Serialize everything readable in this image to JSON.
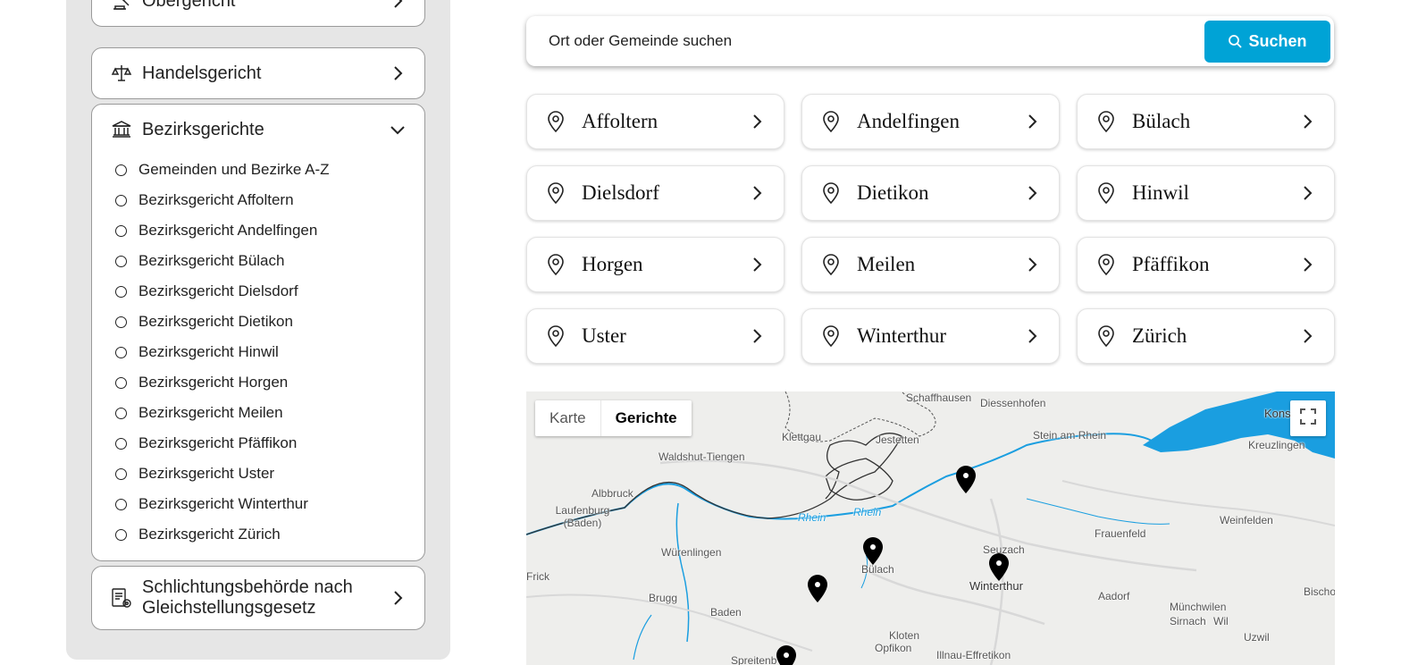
{
  "sidebar": {
    "obergericht": "Obergericht",
    "handelsgericht": "Handelsgericht",
    "bezirksgerichte": "Bezirksgerichte",
    "bezirksgerichte_items": [
      "Gemeinden und Bezirke A-Z",
      "Bezirksgericht Affoltern",
      "Bezirksgericht Andelfingen",
      "Bezirksgericht Bülach",
      "Bezirksgericht Dielsdorf",
      "Bezirksgericht Dietikon",
      "Bezirksgericht Hinwil",
      "Bezirksgericht Horgen",
      "Bezirksgericht Meilen",
      "Bezirksgericht Pfäffikon",
      "Bezirksgericht Uster",
      "Bezirksgericht Winterthur",
      "Bezirksgericht Zürich"
    ],
    "schlichtung_line1": "Schlichtungsbehörde nach",
    "schlichtung_line2": "Gleichstellungsgesetz"
  },
  "search": {
    "placeholder": "Ort oder Gemeinde suchen",
    "button_label": "Suchen"
  },
  "districts": [
    "Affoltern",
    "Andelfingen",
    "Bülach",
    "Dielsdorf",
    "Dietikon",
    "Hinwil",
    "Horgen",
    "Meilen",
    "Pfäffikon",
    "Uster",
    "Winterthur",
    "Zürich"
  ],
  "map": {
    "toggle_map": "Karte",
    "toggle_courts": "Gerichte",
    "places": [
      "Schaffhausen",
      "Diessenhofen",
      "Klettgau",
      "Jestetten",
      "Stein am Rhein",
      "Kons",
      "Kreuzlingen",
      "Waldshut-Tiengen",
      "Albbruck",
      "Laufenburg (Baden)",
      "Rhein",
      "Rhein",
      "Weinfelden",
      "Frauenfeld",
      "Würenlingen",
      "Seuzach",
      "Bülach",
      "Winterthur",
      "Frick",
      "Brugg",
      "Baden",
      "Aadorf",
      "Bischo",
      "Münchwilen",
      "Sirnach",
      "Wil",
      "Kloten",
      "Opfikon",
      "Illnau-Effretikon",
      "Uzwil",
      "Spreitenb"
    ]
  },
  "colors": {
    "accent": "#00a3d6",
    "sidebar_bg": "#e6e6e6",
    "water": "#1a9ee0"
  }
}
